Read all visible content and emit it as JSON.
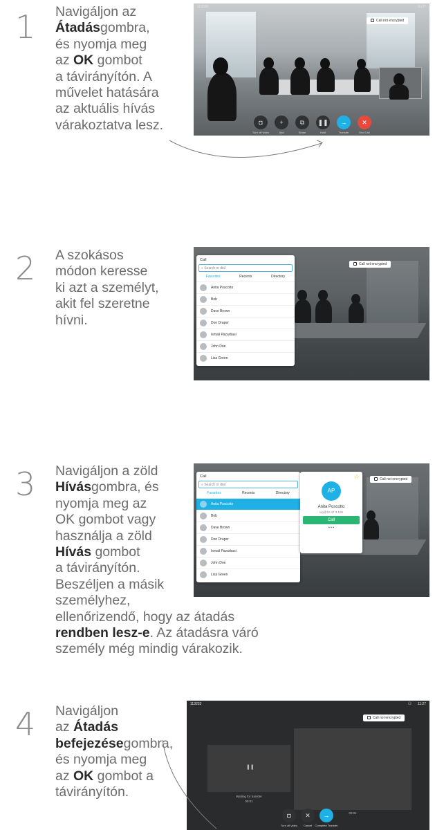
{
  "steps": [
    {
      "number": "1",
      "lines": [
        {
          "parts": [
            {
              "t": "Navigáljon az"
            }
          ]
        },
        {
          "parts": [
            {
              "t": "Átadás",
              "b": true
            },
            {
              "t": "gombra,"
            }
          ]
        },
        {
          "parts": [
            {
              "t": "és nyomja meg"
            }
          ]
        },
        {
          "parts": [
            {
              "t": "az "
            },
            {
              "t": "OK",
              "b": true
            },
            {
              "t": " gombot"
            }
          ]
        },
        {
          "parts": [
            {
              "t": "a távirányítón. A"
            }
          ]
        },
        {
          "parts": [
            {
              "t": "művelet hatására"
            }
          ]
        },
        {
          "parts": [
            {
              "t": "az aktuális hívás"
            }
          ]
        },
        {
          "parts": [
            {
              "t": "várakoztatva lesz."
            }
          ]
        }
      ]
    },
    {
      "number": "2",
      "lines": [
        {
          "parts": [
            {
              "t": "A szokásos"
            }
          ]
        },
        {
          "parts": [
            {
              "t": "módon keresse"
            }
          ]
        },
        {
          "parts": [
            {
              "t": "ki azt a személyt,"
            }
          ]
        },
        {
          "parts": [
            {
              "t": "akit fel szeretne"
            }
          ]
        },
        {
          "parts": [
            {
              "t": "hívni."
            }
          ]
        }
      ]
    },
    {
      "number": "3",
      "lines": [
        {
          "parts": [
            {
              "t": "Navigáljon a zöld"
            }
          ]
        },
        {
          "parts": [
            {
              "t": "Hívás",
              "b": true
            },
            {
              "t": "gombra, és"
            }
          ]
        },
        {
          "parts": [
            {
              "t": "nyomja meg az"
            }
          ]
        },
        {
          "parts": [
            {
              "t": "OK gombot vagy"
            }
          ]
        },
        {
          "parts": [
            {
              "t": "használja a zöld"
            }
          ]
        },
        {
          "parts": [
            {
              "t": "Hívás",
              "b": true
            },
            {
              "t": " gombot"
            }
          ]
        },
        {
          "parts": [
            {
              "t": "a távirányítón."
            }
          ]
        },
        {
          "parts": [
            {
              "t": "Beszéljen a másik"
            }
          ]
        },
        {
          "parts": [
            {
              "t": "személyhez,"
            }
          ]
        },
        {
          "parts": [
            {
              "t": "ellenőrizendő, hogy az átadás"
            }
          ]
        },
        {
          "parts": [
            {
              "t": "rendben lesz-e",
              "b": true
            },
            {
              "t": ". Az átadásra váró"
            }
          ]
        },
        {
          "parts": [
            {
              "t": "személy még mindig várakozik."
            }
          ]
        }
      ]
    },
    {
      "number": "4",
      "lines": [
        {
          "parts": [
            {
              "t": "Navigáljon"
            }
          ]
        },
        {
          "parts": [
            {
              "t": "az "
            },
            {
              "t": "Átadás",
              "b": true
            }
          ]
        },
        {
          "parts": [
            {
              "t": "befejezése",
              "b": true
            },
            {
              "t": "gombra,"
            }
          ]
        },
        {
          "parts": [
            {
              "t": "és nyomja meg"
            }
          ]
        },
        {
          "parts": [
            {
              "t": "az "
            },
            {
              "t": "OK",
              "b": true
            },
            {
              "t": " gombot a"
            }
          ]
        },
        {
          "parts": [
            {
              "t": "távirányítón."
            }
          ]
        }
      ]
    }
  ],
  "screens": {
    "s1": {
      "call_id": "113233",
      "time": "11:27",
      "encryption": "Call not encrypted",
      "controls": [
        "Turn off video",
        "Add",
        "Share",
        "Hold",
        "Transfer",
        "End Call"
      ]
    },
    "s2": {
      "encryption": "Call not encrypted",
      "dir_title": "Call",
      "search_placeholder": "Search or dial",
      "tabs": [
        "Favorites",
        "Recents",
        "Directory"
      ],
      "contacts": [
        "Anita Poscotto",
        "Bob",
        "Dave Brown",
        "Don Draper",
        "Ismail Pazarbasi",
        "John Doe",
        "Lisa Green"
      ]
    },
    "s3": {
      "encryption": "Call not encrypted",
      "dir_title": "Call",
      "search_placeholder": "Search or dial",
      "tabs": [
        "Favorites",
        "Recents",
        "Directory"
      ],
      "contacts": [
        "Anita Poscotto",
        "Bob",
        "Dave Brown",
        "Don Draper",
        "Ismail Pazarbasi",
        "John Doe",
        "Lisa Green"
      ],
      "card_initials": "AP",
      "card_name": "Anita Poscotto",
      "card_address": "ivg@10.47.3.105",
      "card_call": "Call",
      "card_more": "• • •"
    },
    "s4": {
      "call_id": "113233",
      "time": "11:27",
      "encryption": "Call not encrypted",
      "left_caption": "Waiting for transfer",
      "left_time": "00:01",
      "right_time": "00:01",
      "controls": [
        "Turn off video",
        "Cancel",
        "Complete Transfer"
      ]
    }
  },
  "colors": {
    "accent": "#1fb1e6",
    "call_green": "#2bb673",
    "end_red": "#e64a3c"
  }
}
